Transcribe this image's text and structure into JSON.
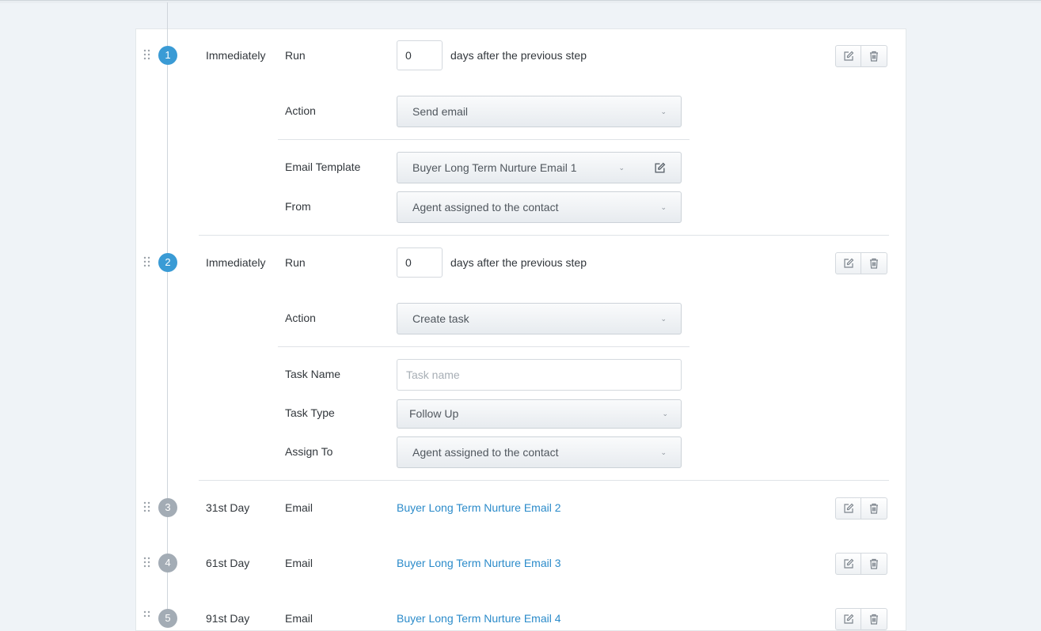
{
  "steps": [
    {
      "number": "1",
      "timing": "Immediately",
      "run_label": "Run",
      "days_value": "0",
      "days_suffix": "days after the previous step",
      "action_label": "Action",
      "action_value": "Send email",
      "email_template_label": "Email Template",
      "email_template_value": "Buyer Long Term Nurture Email 1",
      "from_label": "From",
      "from_value": "Agent assigned to the contact"
    },
    {
      "number": "2",
      "timing": "Immediately",
      "run_label": "Run",
      "days_value": "0",
      "days_suffix": "days after the previous step",
      "action_label": "Action",
      "action_value": "Create task",
      "task_name_label": "Task Name",
      "task_name_placeholder": "Task name",
      "task_type_label": "Task Type",
      "task_type_value": "Follow Up",
      "assign_to_label": "Assign To",
      "assign_to_value": "Agent assigned to the contact"
    },
    {
      "number": "3",
      "timing": "31st Day",
      "type": "Email",
      "template": "Buyer Long Term Nurture Email 2"
    },
    {
      "number": "4",
      "timing": "61st Day",
      "type": "Email",
      "template": "Buyer Long Term Nurture Email 3"
    },
    {
      "number": "5",
      "timing": "91st Day",
      "type": "Email",
      "template": "Buyer Long Term Nurture Email 4"
    }
  ],
  "icons": {
    "drag": "drag-handle-icon",
    "edit": "edit-icon",
    "delete": "trash-icon",
    "caret": "chevron-down-icon"
  },
  "colors": {
    "active_step": "#3a9bd5",
    "inactive_step": "#a3acb5",
    "link": "#2b8bca",
    "background": "#eff3f7"
  }
}
